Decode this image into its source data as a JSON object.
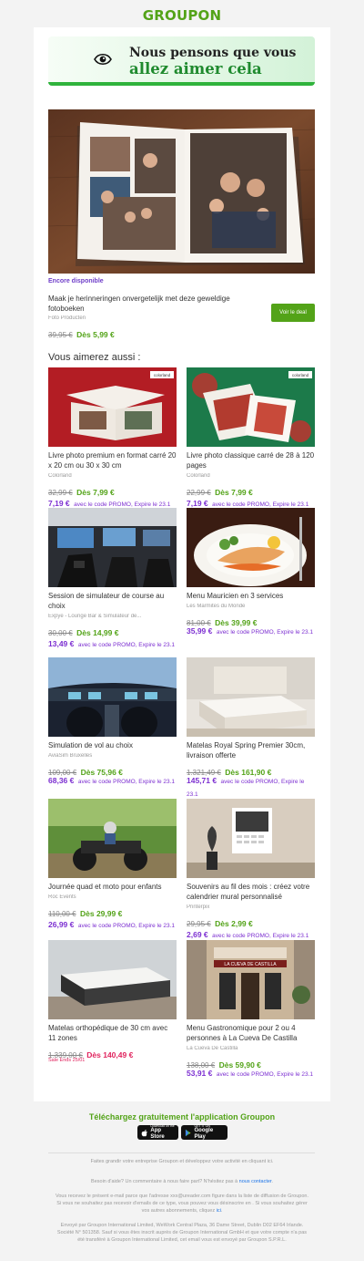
{
  "brand": {
    "logo": "GROUPON",
    "green": "#53a318",
    "purple": "#7c2fd1"
  },
  "hero": {
    "line1": "Nous pensons que vous",
    "line2": "allez aimer cela",
    "icon": "eye-icon"
  },
  "featured": {
    "availability": "Encore disponible",
    "title": "Maak je herinneringen onvergetelijk met deze geweldige fotoboeken",
    "merchant": "Foto Producten",
    "original_price": "39,95 €",
    "price": "Dès 5,99 €",
    "cta": "Voir le deal"
  },
  "section_title": "Vous aimerez aussi :",
  "deals": [
    {
      "title": "Livre photo premium en format carré 20 x 20 cm ou 30 x 30 cm",
      "merchant": "Colorland",
      "original_price": "32,99 €",
      "price": "Dès 7,99 €",
      "promo_price": "7,19 €",
      "promo_text": "avec le code PROMO, Expire le 23.1"
    },
    {
      "title": "Livre photo classique carré de 28 à 120 pages",
      "merchant": "Colorland",
      "original_price": "22,99 €",
      "price": "Dès 7,99 €",
      "promo_price": "7,19 €",
      "promo_text": "avec le code PROMO, Expire le 23.1"
    },
    {
      "title": "Session de simulateur de course au choix",
      "merchant": "Expye - Lounge Bar & Simulateur de...",
      "original_price": "30,00 €",
      "price": "Dès 14,99 €",
      "promo_price": "13,49 €",
      "promo_text": "avec le code PROMO, Expire le 23.1"
    },
    {
      "title": "Menu Mauricien en 3 services",
      "merchant": "Les Marmites du Monde",
      "original_price": "81,00 €",
      "price": "Dès 39,99 €",
      "promo_price": "35,99 €",
      "promo_text": "avec le code PROMO, Expire le 23.1"
    },
    {
      "title": "Simulation de vol au choix",
      "merchant": "AviaSim Bruxelles",
      "original_price": "109,00 €",
      "price": "Dès 75,96 €",
      "promo_price": "68,36 €",
      "promo_text": "avec le code PROMO, Expire le 23.1"
    },
    {
      "title": "Matelas Royal Spring Premier 30cm, livraison offerte",
      "merchant": "",
      "original_price": "1.321,49 €",
      "price": "Dès 161,90 €",
      "promo_price": "145,71 €",
      "promo_text": "avec le code PROMO, Expire le 23.1"
    },
    {
      "title": "Journée quad et moto pour enfants",
      "merchant": "Roc Events",
      "original_price": "110,00 €",
      "price": "Dès 29,99 €",
      "promo_price": "26,99 €",
      "promo_text": "avec le code PROMO, Expire le 23.1"
    },
    {
      "title": "Souvenirs au fil des mois : créez votre calendrier mural personnalisé",
      "merchant": "Printerpix",
      "original_price": "29,95 €",
      "price": "Dès 2,99 €",
      "promo_price": "2,69 €",
      "promo_text": "avec le code PROMO, Expire le 23.1"
    },
    {
      "title": "Matelas orthopédique de 30 cm avec 11 zones",
      "merchant": "",
      "original_price": "1.339,00 €",
      "price": "Dès 140,49 €",
      "sale_text": "Sale Ends 25/01"
    },
    {
      "title": "Menu Gastronomique pour 2 ou 4 personnes à La Cueva De Castilla",
      "merchant": "La Cueva De Castilla",
      "original_price": "138,00 €",
      "price": "Dès 59,90 €",
      "promo_price": "53,91 €",
      "promo_text": "avec le code PROMO, Expire le 23.1"
    }
  ],
  "image_tags": {
    "colorland": "colorland"
  },
  "sign": {
    "cueva": "LA CUEVA DE CASTILLA"
  },
  "app": {
    "heading": "Téléchargez gratuitement l'application Groupon",
    "appstore_top": "Download on the",
    "appstore": "App Store",
    "googleplay_top": "GET IT ON",
    "googleplay": "Google Play"
  },
  "footer": {
    "business": "Faites grandir votre entreprise Groupon et développez votre activité en cliquant ici.",
    "help": "Besoin d'aide? Un commentaire à nous faire part? N'hésitez pas à",
    "help_link": "nous contacter",
    "help_end": ".",
    "notice": "Vous recevez le présent e-mail parce que l'adresse xxx@ureader.com figure dans la liste de diffusion de Groupon. Si vous ne souhaitez pas recevoir d'emails de ce type, vous pouvez vous désinscrire en . Si vous souhaitez gérer vos autres abonnements, cliquez",
    "notice_link": "ici",
    "notice_end": ".",
    "legal": "Envoyé par Groupon International Limited, WeWork Central Plaza, 36 Dame Street, Dublin D02 EF64 Irlande. Société N° 501358. Sauf si vous êtes inscrit auprès de Groupon International GmbH et que votre compte n'a pas été transféré à Groupon International Limited, cet email vous est envoyé par Groupon S.P.R.L."
  }
}
